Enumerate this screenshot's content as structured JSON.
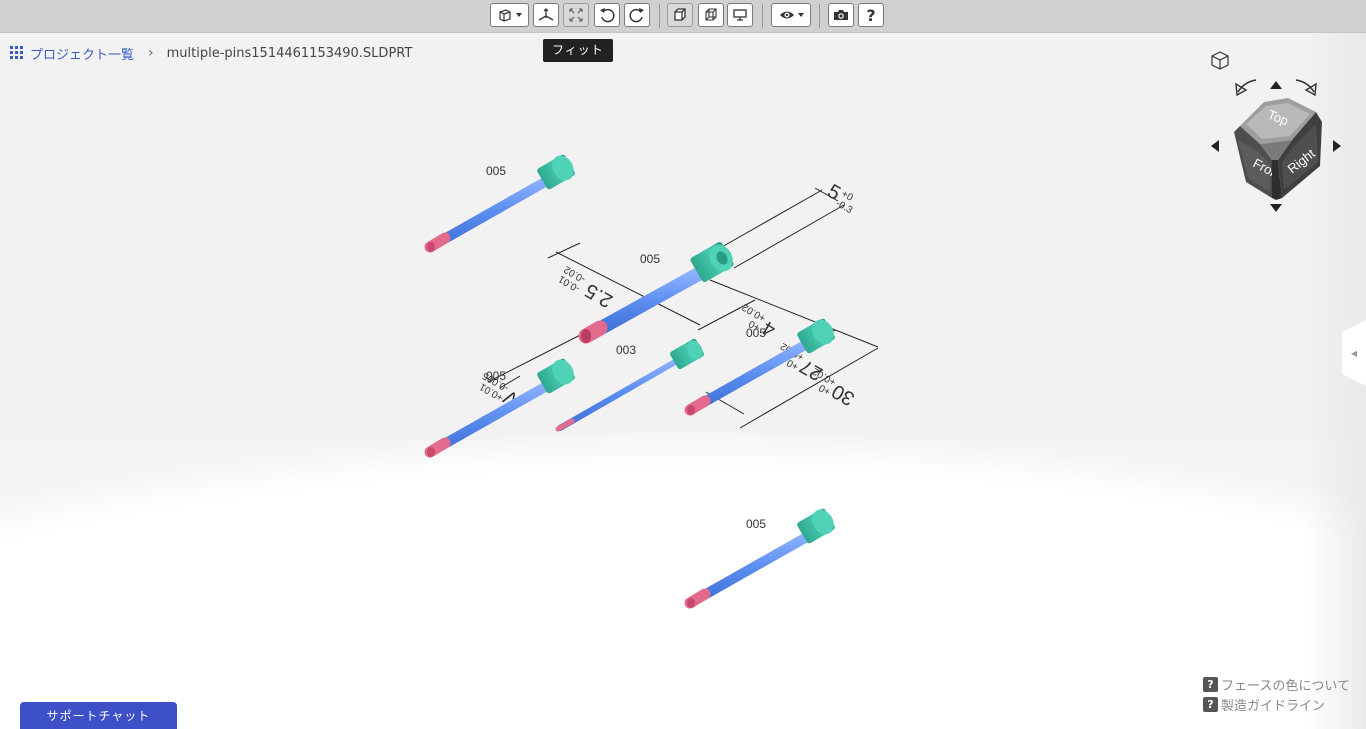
{
  "toolbar": {
    "buttons": [
      {
        "name": "view-mode-button",
        "icon": "cube-view-icon",
        "has_dropdown": true
      },
      {
        "name": "section-button",
        "icon": "axes-icon"
      },
      {
        "name": "fit-button",
        "icon": "fit-arrows-icon",
        "active": true
      },
      {
        "name": "rotate-left-button",
        "icon": "rotate-ccw-icon"
      },
      {
        "name": "rotate-right-button",
        "icon": "rotate-cw-icon"
      },
      {
        "name": "shaded-button",
        "icon": "solid-box-icon"
      },
      {
        "name": "wireframe-button",
        "icon": "wireframe-box-icon"
      },
      {
        "name": "presentation-button",
        "icon": "monitor-icon"
      },
      {
        "name": "visibility-button",
        "icon": "eye-icon",
        "has_dropdown": true
      },
      {
        "name": "screenshot-button",
        "icon": "camera-icon"
      },
      {
        "name": "help-button",
        "icon": "question-icon"
      }
    ],
    "tooltip": "フィット"
  },
  "breadcrumb": {
    "project_list": "プロジェクト一覧",
    "separator": "›",
    "current_file": "multiple-pins1514461153490.SLDPRT"
  },
  "model": {
    "pin_labels": [
      "005",
      "005",
      "003",
      "005",
      "005",
      "005"
    ],
    "colors": {
      "shaft": "#5b8def",
      "head": "#3cbfa6",
      "tip": "#e46a8c",
      "dimension": "#222222"
    },
    "dimensions": [
      {
        "value": "5",
        "upper_tol": "+0",
        "lower_tol": "-0.3"
      },
      {
        "value": "2.5",
        "upper_tol": "-0.01",
        "lower_tol": "-0.02"
      },
      {
        "value": "4",
        "upper_tol": "+0",
        "lower_tol": "+0.02"
      },
      {
        "value": "27",
        "upper_tol": "+0",
        "lower_tol": "+0.02"
      },
      {
        "value": "30",
        "upper_tol": "+0",
        "lower_tol": "+0.02"
      },
      {
        "value": "V",
        "upper_tol": "+0.01",
        "lower_tol": "-0.005"
      }
    ]
  },
  "navcube": {
    "faces": {
      "top": "Top",
      "front": "Front",
      "right": "Right"
    },
    "arrows": [
      "arrow-up-icon",
      "arrow-down-icon",
      "arrow-left-icon",
      "arrow-right-icon",
      "rotate-ccw-icon",
      "rotate-cw-icon"
    ],
    "home_icon": "home-cube-icon"
  },
  "help": {
    "face_colors": "フェースの色について",
    "manufacturing_guide": "製造ガイドライン",
    "icon_label": "?"
  },
  "support_chat": {
    "label": "サポートチャット"
  }
}
